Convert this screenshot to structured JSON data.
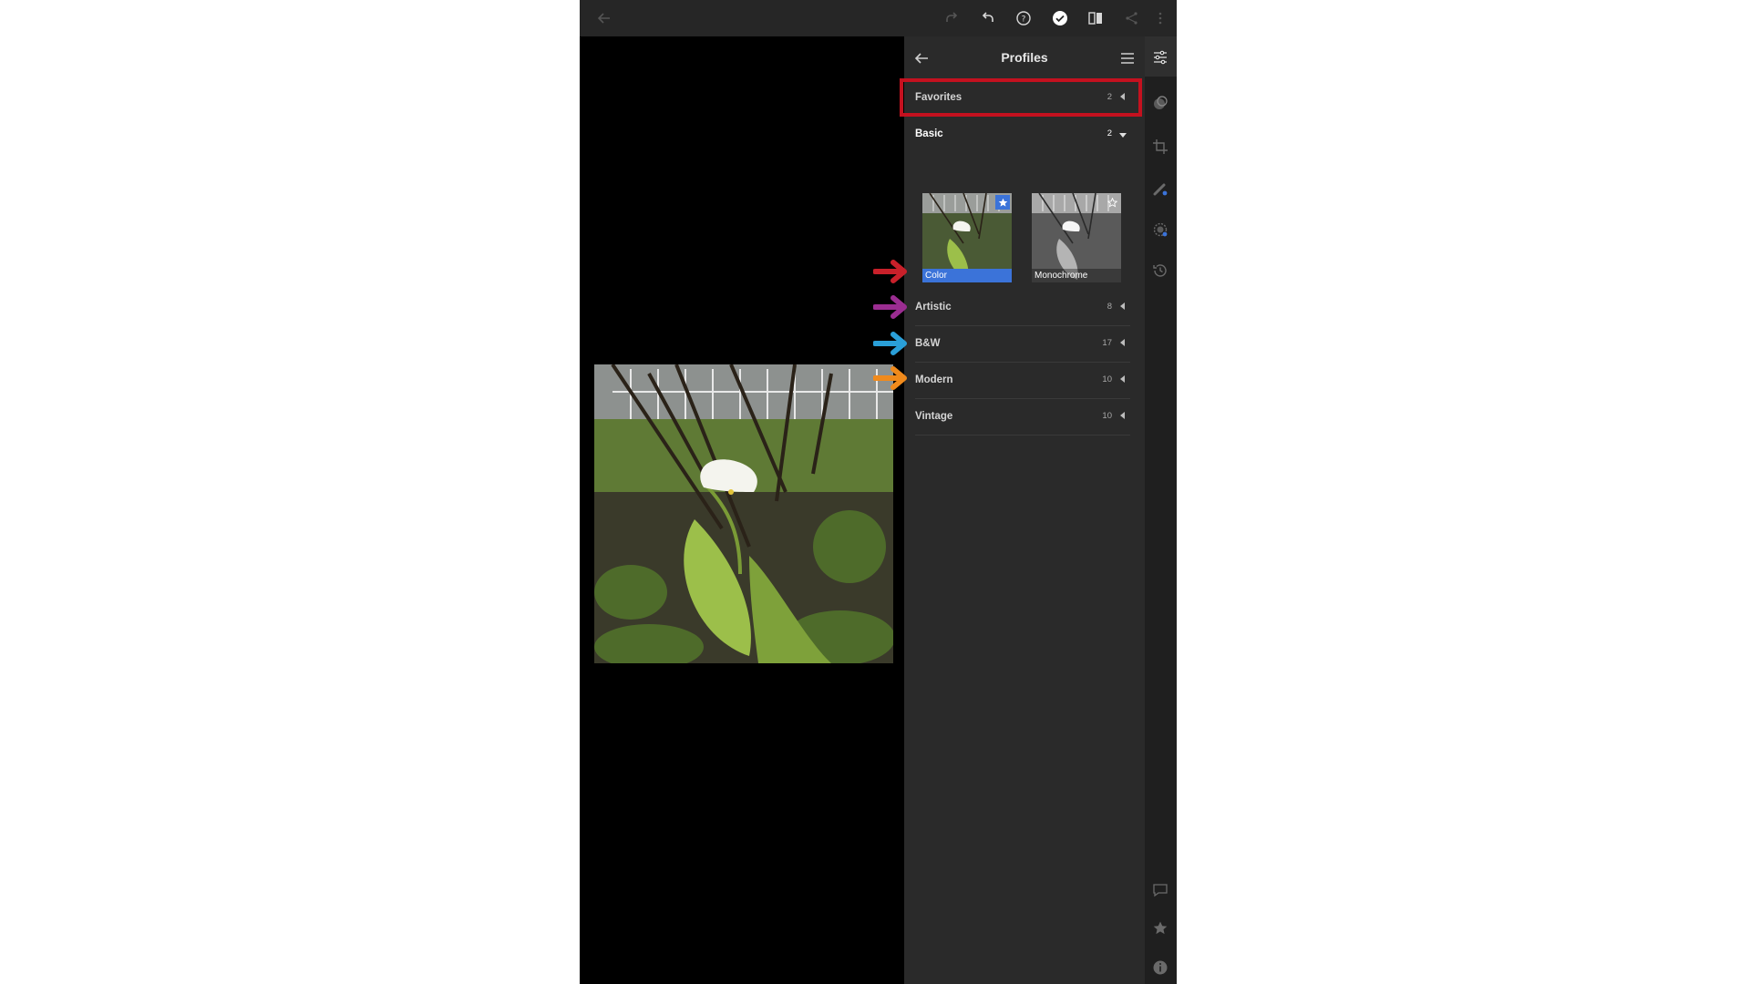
{
  "toolbar": {
    "icons": [
      "back-arrow-icon",
      "redo-icon",
      "undo-icon",
      "help-icon",
      "done-check-icon",
      "compare-icon",
      "share-icon",
      "more-vertical-icon"
    ]
  },
  "panel": {
    "title": "Profiles",
    "categories": [
      {
        "label": "Favorites",
        "count": "2",
        "expanded": false,
        "highlighted": true
      },
      {
        "label": "Basic",
        "count": "2",
        "expanded": true
      },
      {
        "label": "Artistic",
        "count": "8",
        "expanded": false,
        "arrow_color": "#c8202a"
      },
      {
        "label": "B&W",
        "count": "17",
        "expanded": false,
        "arrow_color": "#9b2d91"
      },
      {
        "label": "Modern",
        "count": "10",
        "expanded": false,
        "arrow_color": "#2a9fd8"
      },
      {
        "label": "Vintage",
        "count": "10",
        "expanded": false,
        "arrow_color": "#f08a1c"
      }
    ],
    "thumbnails": [
      {
        "label": "Color",
        "selected": true,
        "favorite": true
      },
      {
        "label": "Monochrome",
        "selected": false,
        "favorite": false
      }
    ]
  },
  "strip": {
    "icons": [
      "edit-sliders-icon",
      "presets-icon",
      "crop-icon",
      "healing-icon",
      "selective-icon",
      "versions-history-icon",
      "comment-icon",
      "rating-star-icon",
      "info-icon"
    ]
  },
  "colors": {
    "highlight": "#c4111f",
    "selected": "#3b73d9"
  }
}
